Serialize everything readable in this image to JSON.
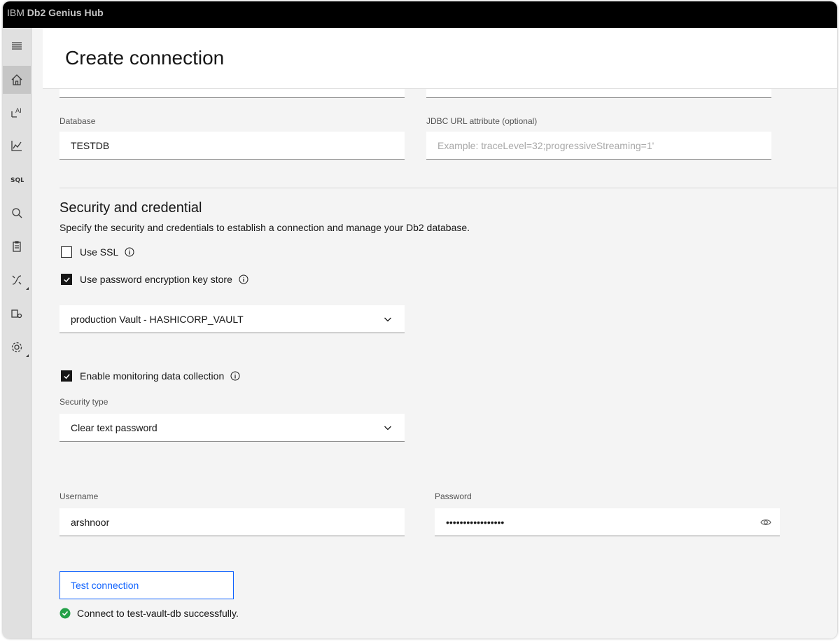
{
  "app": {
    "brand": "IBM",
    "product": "Db2 Genius Hub"
  },
  "page": {
    "title": "Create connection"
  },
  "nav_rail": [
    {
      "name": "menu-icon"
    },
    {
      "name": "home-icon"
    },
    {
      "name": "ai-icon"
    },
    {
      "name": "monitor-chart-icon"
    },
    {
      "name": "sql-icon"
    },
    {
      "name": "query-search-icon"
    },
    {
      "name": "clipboard-icon"
    },
    {
      "name": "migration-icon"
    },
    {
      "name": "admin-settings-icon"
    },
    {
      "name": "settings-gear-icon"
    }
  ],
  "form": {
    "database": {
      "label": "Database",
      "value": "TESTDB"
    },
    "jdbc": {
      "label": "JDBC URL attribute (optional)",
      "placeholder": "Example: traceLevel=32;progressiveStreaming=1'"
    },
    "security": {
      "title": "Security and credential",
      "description": "Specify the security and credentials to establish a connection and manage your Db2 database.",
      "use_ssl": {
        "label": "Use SSL",
        "checked": false
      },
      "use_keystore": {
        "label": "Use password encryption key store",
        "checked": true
      },
      "keystore_select": {
        "value": "production Vault - HASHICORP_VAULT"
      },
      "monitoring": {
        "label": "Enable monitoring data collection",
        "checked": true
      },
      "security_type": {
        "label": "Security type",
        "value": "Clear text password"
      },
      "username": {
        "label": "Username",
        "value": "arshnoor"
      },
      "password": {
        "label": "Password",
        "value": "•••••••••••••••••"
      }
    },
    "test_button": {
      "label": "Test connection"
    },
    "status": {
      "message": "Connect to test-vault-db successfully.",
      "color": "#24a148"
    }
  },
  "colors": {
    "accent": "#0f62fe",
    "topbar": "#000000",
    "success": "#24a148"
  }
}
